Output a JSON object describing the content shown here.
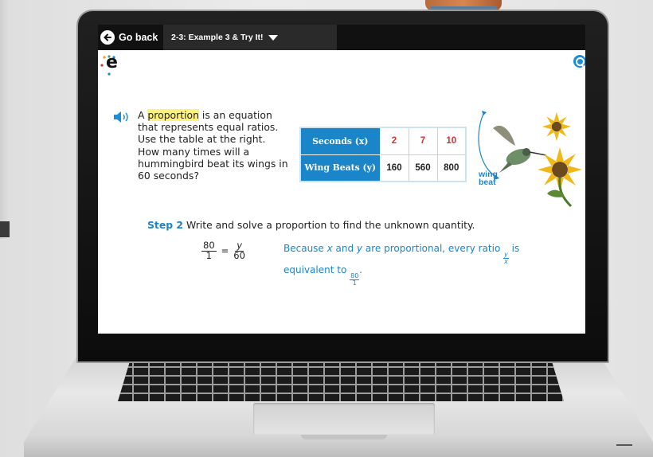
{
  "topbar": {
    "go_back_label": "Go back",
    "lesson_title": "2-3: Example 3 & Try It!"
  },
  "logo": {
    "text": "e"
  },
  "problem": {
    "prefix": "A ",
    "keyword": "proportion",
    "body": " is an equation that represents equal ratios. Use the table at the right. How many times will a hummingbird beat its wings in 60 seconds?"
  },
  "table": {
    "row1_header": "Seconds (x)",
    "row1_values": [
      "2",
      "7",
      "10"
    ],
    "row2_header": "Wing Beats (y)",
    "row2_values": [
      "160",
      "560",
      "800"
    ]
  },
  "image": {
    "label_line1": "wing",
    "label_line2": "beat"
  },
  "step": {
    "number": "Step 2",
    "text": "Write and solve a proportion to find the unknown quantity."
  },
  "equation": {
    "lhs_num": "80",
    "lhs_den": "1",
    "equals": "=",
    "rhs_num": "y",
    "rhs_den": "60"
  },
  "explanation": {
    "part1": "Because ",
    "var_x": "x",
    "part2": " and ",
    "var_y": "y",
    "part3": " are proportional, every ratio ",
    "ratio_num": "y",
    "ratio_den": "x",
    "part4": " is equivalent to ",
    "eq_num": "80",
    "eq_den": "1",
    "part5": "."
  },
  "colors": {
    "accent": "#1a85c8",
    "table_red": "#d0342c",
    "highlight": "#fff27a",
    "topbar": "#111111"
  }
}
